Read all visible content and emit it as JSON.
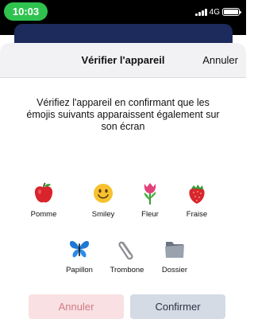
{
  "status_bar": {
    "time": "10:03",
    "network": "4G"
  },
  "sheet": {
    "title": "Vérifier l'appareil",
    "cancel_label": "Annuler",
    "instructions": "Vérifiez l'appareil en confirmant que les émojis suivants apparaissent également sur son écran"
  },
  "emojis": [
    {
      "label": "Pomme",
      "icon": "apple-icon"
    },
    {
      "label": "Smiley",
      "icon": "smiley-icon"
    },
    {
      "label": "Fleur",
      "icon": "tulip-icon"
    },
    {
      "label": "Fraise",
      "icon": "strawberry-icon"
    },
    {
      "label": "Papillon",
      "icon": "butterfly-icon"
    },
    {
      "label": "Trombone",
      "icon": "paperclip-icon"
    },
    {
      "label": "Dossier",
      "icon": "folder-icon"
    }
  ],
  "footer": {
    "cancel_label": "Annuler",
    "confirm_label": "Confirmer"
  },
  "colors": {
    "status_green": "#2fc24f",
    "cancel_bg": "#f8e0e3",
    "cancel_text": "#d17a83",
    "confirm_bg": "#d4dbe5"
  }
}
